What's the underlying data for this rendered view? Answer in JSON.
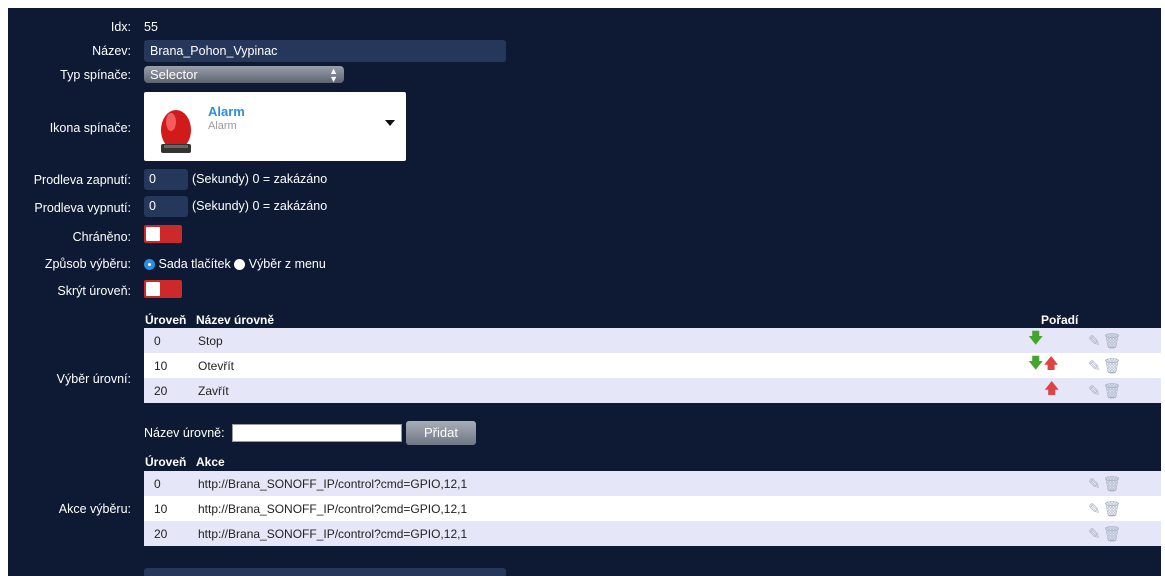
{
  "form": {
    "idx": {
      "label": "Idx:",
      "value": "55"
    },
    "name": {
      "label": "Název:",
      "value": "Brana_Pohon_Vypinac"
    },
    "switch_type": {
      "label": "Typ spínače:",
      "value": "Selector"
    },
    "icon": {
      "label": "Ikona spínače:",
      "title": "Alarm",
      "subtitle": "Alarm"
    },
    "on_delay": {
      "label": "Prodleva zapnutí:",
      "value": "0",
      "hint": "(Sekundy) 0 = zakázáno"
    },
    "off_delay": {
      "label": "Prodleva vypnutí:",
      "value": "0",
      "hint": "(Sekundy) 0 = zakázáno"
    },
    "protected": {
      "label": "Chráněno:"
    },
    "selection_mode": {
      "label": "Způsob výběru:",
      "option_buttons": "Sada tlačítek",
      "option_menu": "Výběr z menu",
      "selected": "Sada tlačítek"
    },
    "hide_level": {
      "label": "Skrýt úroveň:"
    }
  },
  "levels": {
    "label": "Výběr úrovní:",
    "col_level": "Úroveň",
    "col_name": "Název úrovně",
    "col_order": "Pořadí",
    "rows": [
      {
        "level": "0",
        "name": "Stop"
      },
      {
        "level": "10",
        "name": "Otevřít"
      },
      {
        "level": "20",
        "name": "Zavřít"
      }
    ],
    "new_level_label": "Název úrovně:",
    "add_button": "Přidat"
  },
  "actions": {
    "label": "Akce výběru:",
    "col_level": "Úroveň",
    "col_action": "Akce",
    "rows": [
      {
        "level": "0",
        "action": "http://Brana_SONOFF_IP/control?cmd=GPIO,12,1"
      },
      {
        "level": "10",
        "action": "http://Brana_SONOFF_IP/control?cmd=GPIO,12,1"
      },
      {
        "level": "20",
        "action": "http://Brana_SONOFF_IP/control?cmd=GPIO,12,1"
      }
    ]
  },
  "colors": {
    "panel_bg": "#0e1a33",
    "field_bg": "#25375a",
    "toggle_red": "#cc2a2a",
    "row_alt": "#e5e7f8"
  }
}
